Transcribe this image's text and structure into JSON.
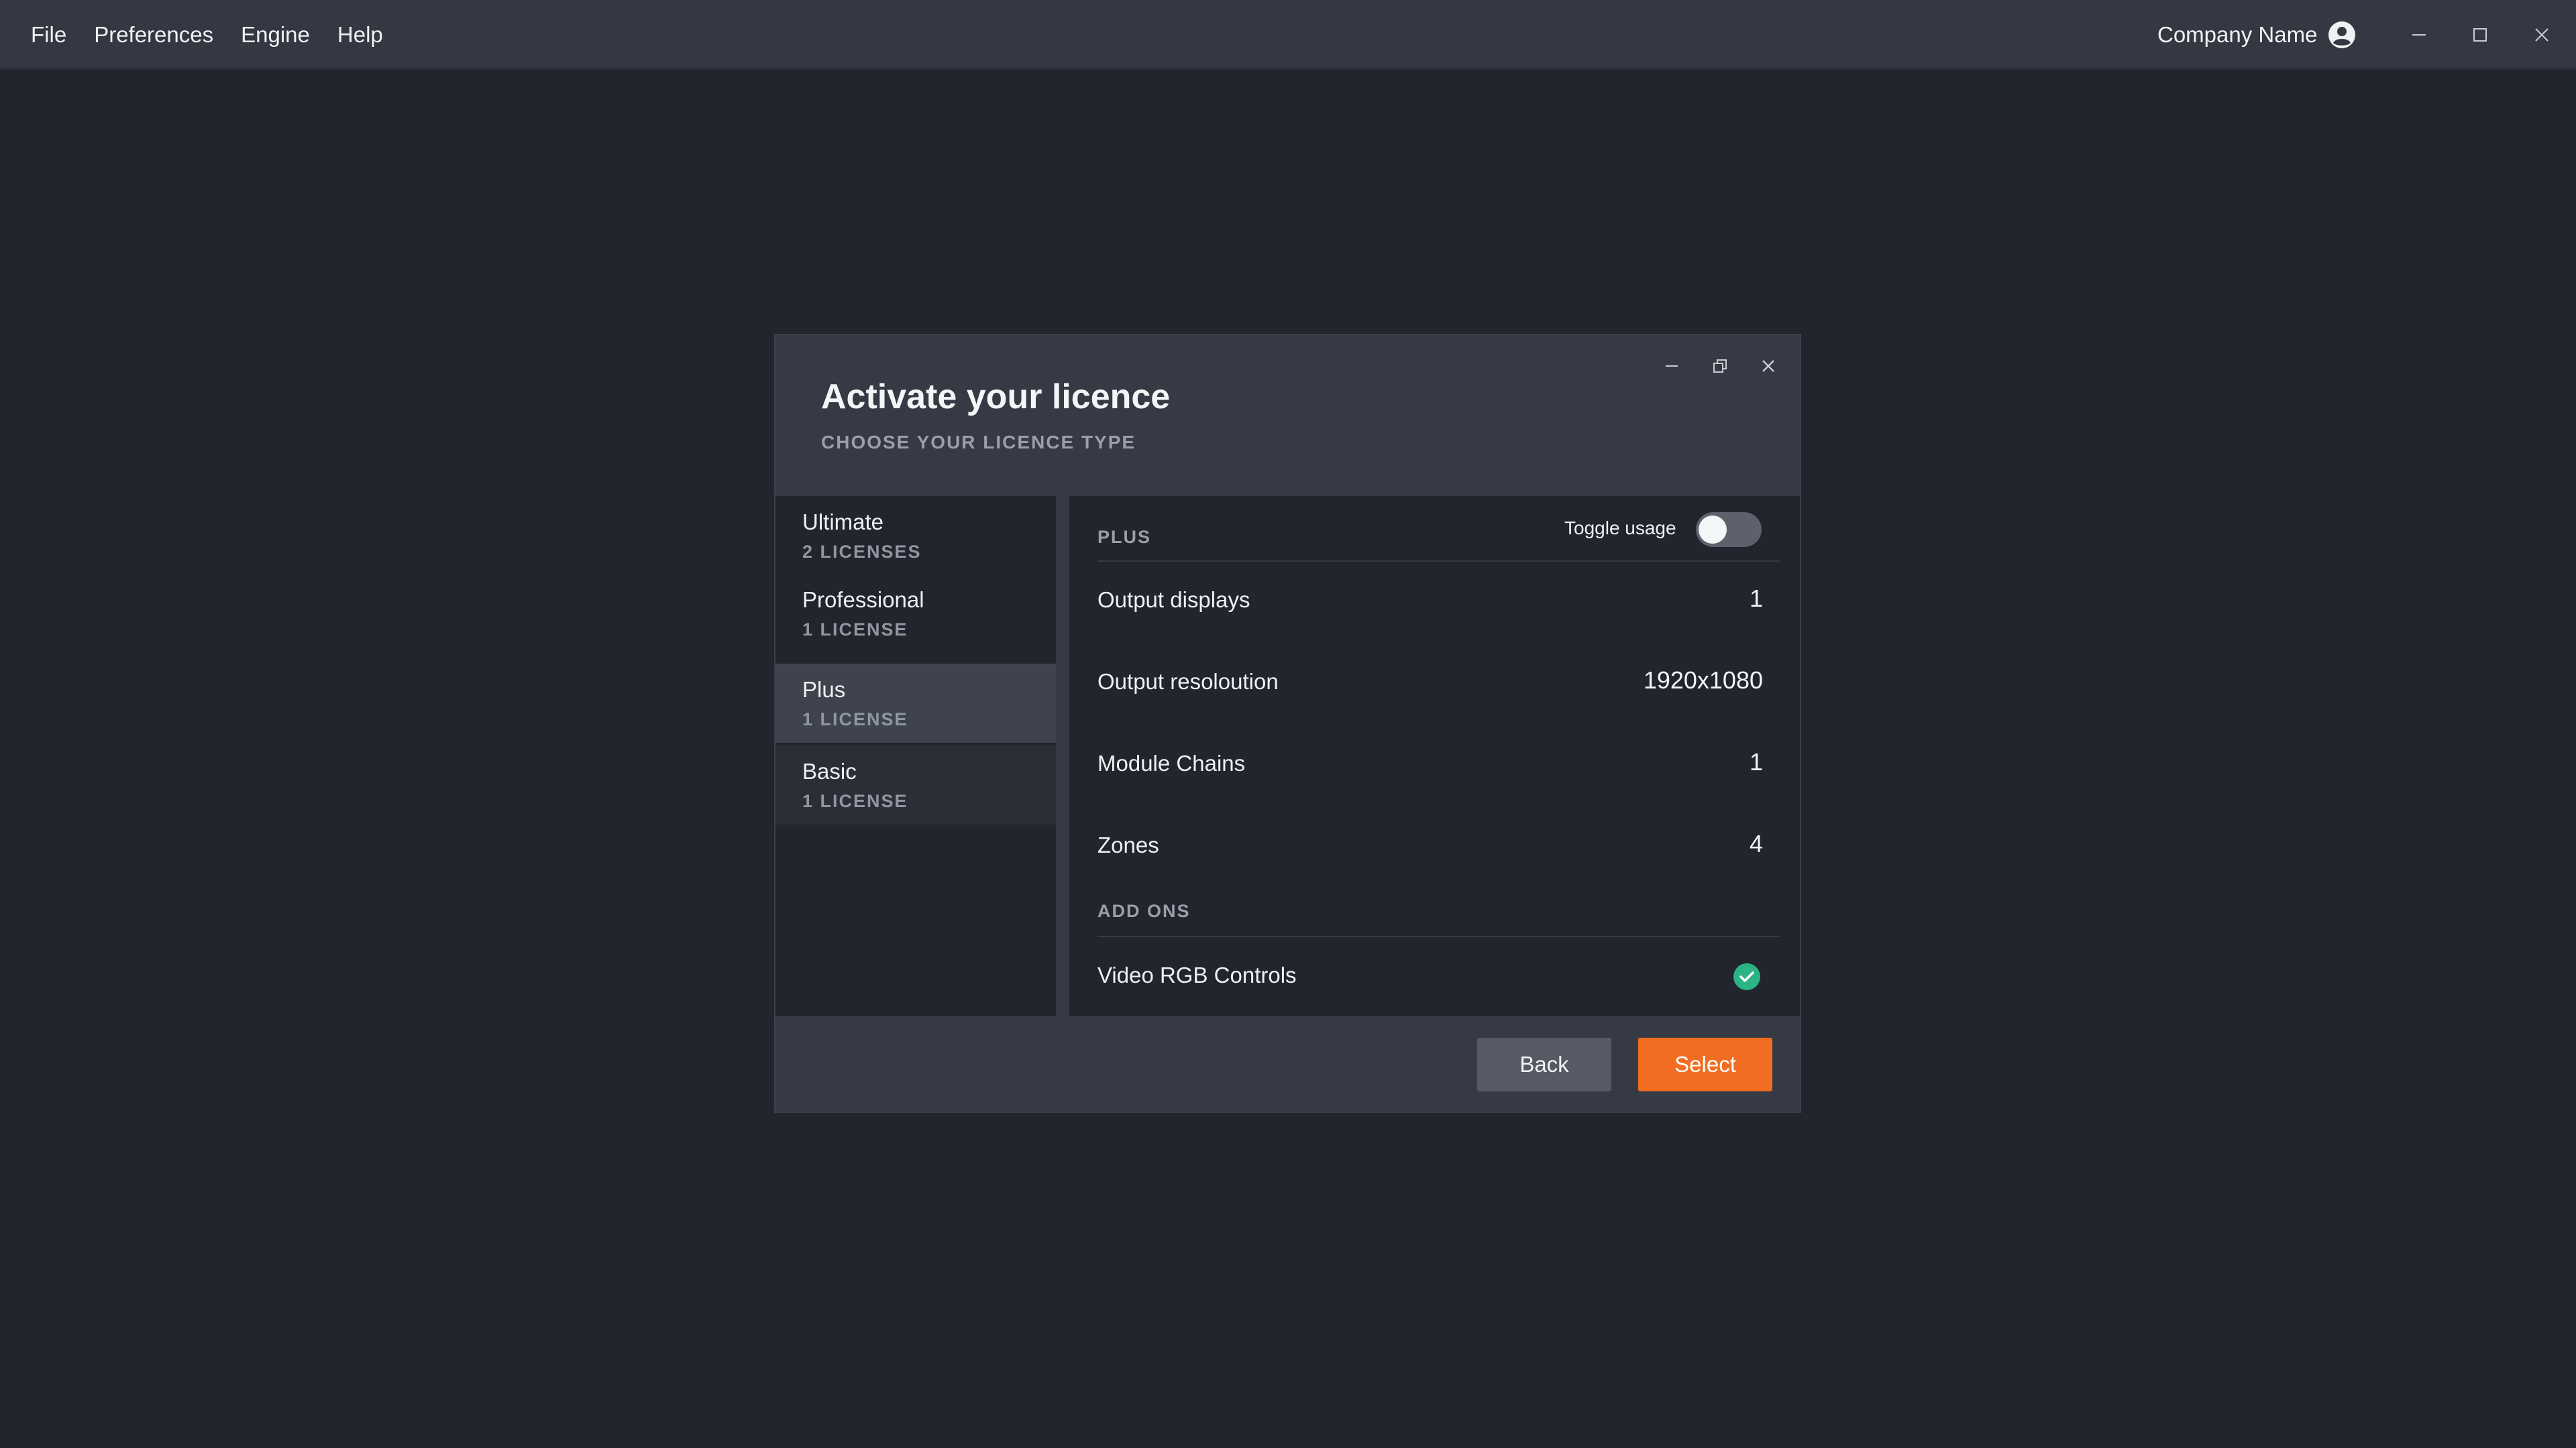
{
  "menubar": {
    "items": [
      "File",
      "Preferences",
      "Engine",
      "Help"
    ]
  },
  "account": {
    "name": "Company Name",
    "icon": "account-circle-icon"
  },
  "window_controls": [
    "minimize-icon",
    "maximize-icon",
    "close-icon"
  ],
  "dialog": {
    "title": "Activate your licence",
    "subtitle": "CHOOSE YOUR LICENCE TYPE",
    "controls": [
      "minimize-icon",
      "restore-icon",
      "close-icon"
    ],
    "licenses": [
      {
        "name": "Ultimate",
        "count": "2 LICENSES"
      },
      {
        "name": "Professional",
        "count": "1 LICENSE"
      },
      {
        "name": "Plus",
        "count": "1 LICENSE"
      },
      {
        "name": "Basic",
        "count": "1 LICENSE"
      }
    ],
    "selected_license": "Plus",
    "detail": {
      "section_title": "PLUS",
      "toggle_label": "Toggle usage",
      "toggle_on": false,
      "rows": [
        {
          "label": "Output displays",
          "value": "1"
        },
        {
          "label": "Output resoloution",
          "value": "1920x1080"
        },
        {
          "label": "Module Chains",
          "value": "1"
        },
        {
          "label": "Zones",
          "value": "4"
        }
      ],
      "addons_title": "ADD ONS",
      "addons": [
        {
          "label": "Video RGB Controls",
          "enabled": true,
          "icon": "check-circle-icon"
        }
      ]
    },
    "buttons": {
      "back": "Back",
      "select": "Select"
    }
  },
  "colors": {
    "background": "#22252d",
    "titlebar": "#343842",
    "accent": "#f26d21",
    "success": "#2bb585"
  }
}
